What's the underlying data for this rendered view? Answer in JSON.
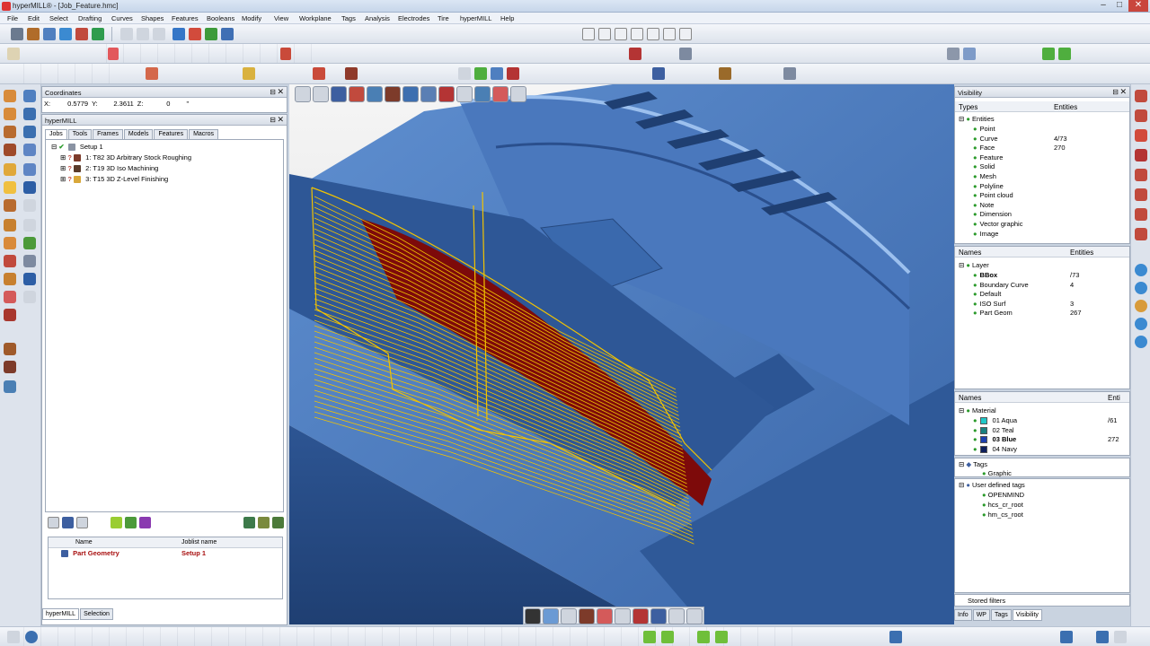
{
  "window": {
    "title": "hyperMILL® - [Job_Feature.hmc]",
    "minimize": "–",
    "maximize": "□",
    "close": "✕"
  },
  "menu": [
    "File",
    "Edit",
    "Select",
    "Drafting",
    "Curves",
    "Shapes",
    "Features",
    "Booleans",
    "Modify",
    "View",
    "Workplane",
    "Tags",
    "Analysis",
    "Electrodes",
    "Tire",
    "hyperMILL",
    "Help"
  ],
  "coordinates": {
    "title": "Coordinates",
    "x_label": "X:",
    "x_value": "0.5779",
    "y_label": "Y:",
    "y_value": "2.3611",
    "z_label": "Z:",
    "z_value": "0",
    "unit": "\""
  },
  "hypermill_panel": {
    "title": "hyperMILL",
    "tabs": [
      "Jobs",
      "Tools",
      "Frames",
      "Models",
      "Features",
      "Macros"
    ],
    "setup": "Setup 1",
    "jobs": [
      "1: T82 3D Arbitrary Stock Roughing",
      "2: T19 3D Iso Machining",
      "3: T15 3D Z-Level Finishing"
    ],
    "table_headers": [
      "Name",
      "Joblist name"
    ],
    "row": {
      "name": "Part Geometry",
      "joblist": "Setup 1"
    },
    "bottom_tabs": [
      "hyperMILL",
      "Selection"
    ]
  },
  "visibility": {
    "title": "Visibility",
    "types_header": [
      "Types",
      "Entities"
    ],
    "root": "Entities",
    "types": [
      {
        "label": "Point",
        "count": ""
      },
      {
        "label": "Curve",
        "count": "4/73"
      },
      {
        "label": "Face",
        "count": "270"
      },
      {
        "label": "Feature",
        "count": ""
      },
      {
        "label": "Solid",
        "count": ""
      },
      {
        "label": "Mesh",
        "count": ""
      },
      {
        "label": "Polyline",
        "count": ""
      },
      {
        "label": "Point cloud",
        "count": ""
      },
      {
        "label": "Note",
        "count": ""
      },
      {
        "label": "Dimension",
        "count": ""
      },
      {
        "label": "Vector graphic",
        "count": ""
      },
      {
        "label": "Image",
        "count": ""
      }
    ],
    "names_header": [
      "Names",
      "Entities"
    ],
    "layer_root": "Layer",
    "layers": [
      {
        "label": "BBox",
        "count": "/73"
      },
      {
        "label": "Boundary Curve",
        "count": "4"
      },
      {
        "label": "Default",
        "count": ""
      },
      {
        "label": "ISO Surf",
        "count": "3"
      },
      {
        "label": "Part Geom",
        "count": "267"
      }
    ],
    "material_header": [
      "Names",
      "Enti"
    ],
    "material_root": "Material",
    "materials": [
      {
        "label": "01 Aqua",
        "count": "/61",
        "color": "#1fc7c7"
      },
      {
        "label": "02 Teal",
        "count": "",
        "color": "#1a7f7f"
      },
      {
        "label": "03 Blue",
        "count": "272",
        "color": "#1c3fae"
      },
      {
        "label": "04 Navy",
        "count": "",
        "color": "#0d1f5c"
      }
    ],
    "tags_root": "Tags",
    "tags": [
      "Graphic"
    ],
    "user_tags_root": "User defined tags",
    "user_tags": [
      "OPENMIND",
      "hcs_cr_root",
      "hm_cs_root"
    ],
    "stored_filters": "Stored filters",
    "bottom_tabs": [
      "Info",
      "WP",
      "Tags",
      "Visibility"
    ]
  },
  "colors": {
    "part_blue": "#3e6eb3",
    "part_dark": "#284f8a",
    "toolpath": "#f2c300",
    "surface_red": "#7d0a0a"
  }
}
